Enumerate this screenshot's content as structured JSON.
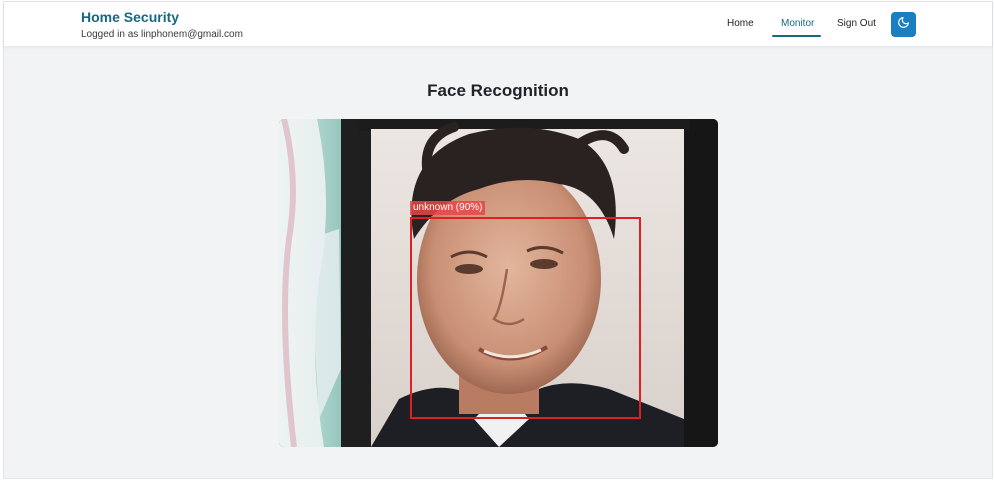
{
  "header": {
    "brand_title": "Home Security",
    "brand_subtitle": "Logged in as linphonem@gmail.com",
    "nav": {
      "home": "Home",
      "monitor": "Monitor",
      "sign_out": "Sign Out"
    },
    "theme_toggle_icon": "moon-icon"
  },
  "main": {
    "title": "Face Recognition",
    "video": {
      "detection_label": "unknown (90%)",
      "detection_color": "#e02020"
    }
  },
  "colors": {
    "brand": "#17697f",
    "accent_button": "#1a7fc1",
    "page_bg": "#f2f3f5"
  }
}
